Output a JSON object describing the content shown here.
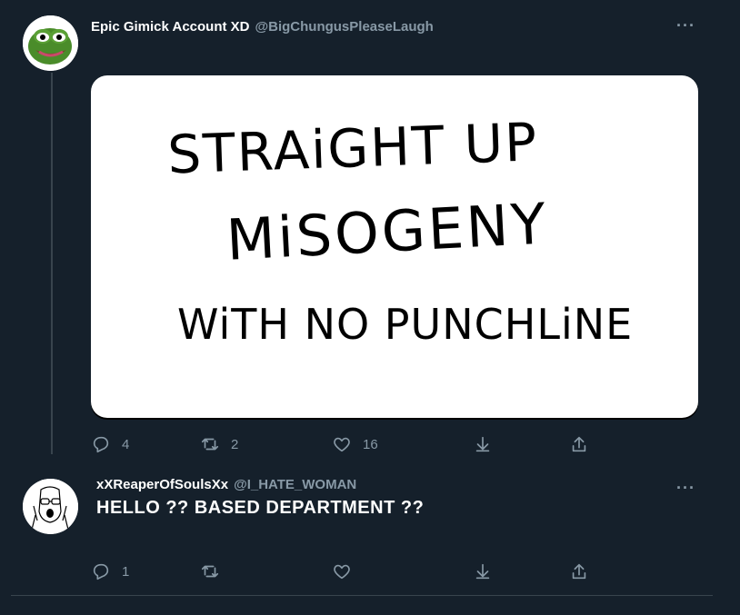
{
  "tweet1": {
    "display_name": "Epic Gimick Account XD",
    "handle": "@BigChungusPleaseLaugh",
    "more": "···",
    "image_text": {
      "line1": "STRAiGHT UP",
      "line2": "MiSOGENY",
      "line3": "WiTH NO PUNCHLiNE"
    },
    "actions": {
      "reply_count": "4",
      "retweet_count": "2",
      "like_count": "16"
    }
  },
  "tweet2": {
    "display_name": "xXReaperOfSoulsXx",
    "handle": "@I_HATE_WOMAN",
    "more": "···",
    "text": "HELLO ?? BASED DEPARTMENT ??",
    "actions": {
      "reply_count": "1",
      "retweet_count": "",
      "like_count": ""
    }
  },
  "icons": {
    "reply": "reply-icon",
    "retweet": "retweet-icon",
    "like": "heart-icon",
    "share": "share-icon",
    "upload": "upload-icon"
  },
  "colors": {
    "background": "#15202b",
    "muted": "#8899a6",
    "border": "#38444d"
  }
}
